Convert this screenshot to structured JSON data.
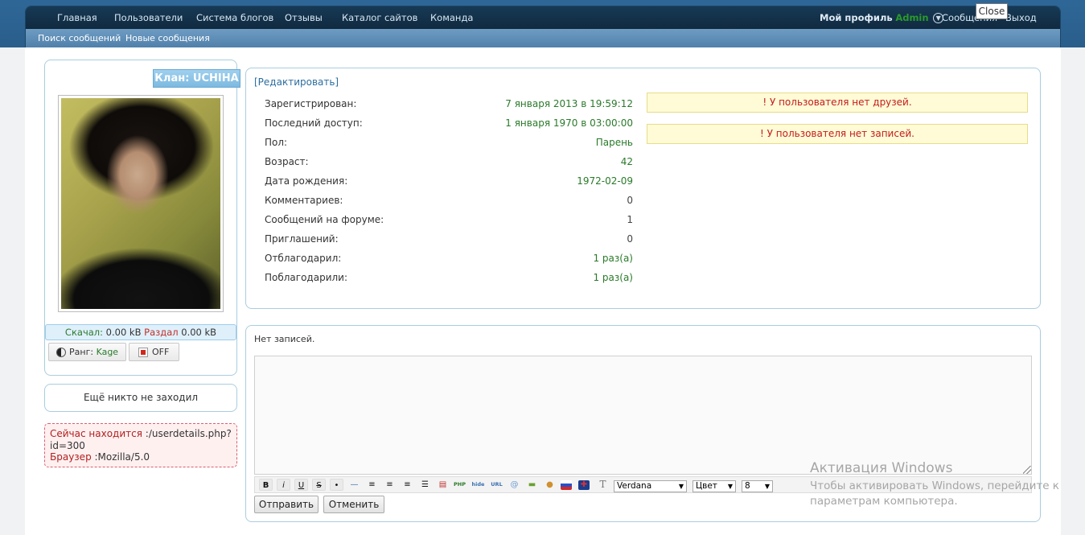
{
  "nav": {
    "main": [
      "Главная",
      "Пользователи",
      "Система блогов",
      "Отзывы",
      "Каталог сайтов",
      "Команда"
    ],
    "right": {
      "profile_label": "Мой профиль",
      "username": "Admin",
      "messages": "Сообщения",
      "logout": "Выход"
    },
    "sub": [
      "Поиск сообщений",
      "Новые сообщения"
    ]
  },
  "tooltip": {
    "close": "Close"
  },
  "sidebar": {
    "clan": "Клан: UCHIHA",
    "ratio": {
      "downloaded_label": "Скачал:",
      "downloaded_value": "0.00 kB",
      "uploaded_label": "Раздал",
      "uploaded_value": "0.00 kB"
    },
    "rank_label": "Ранг:",
    "rank_value": "Kage",
    "status": "OFF",
    "visitors": "Ещё никто не заходил",
    "location_label": "Сейчас находится",
    "location_value": ":/userdetails.php?id=300",
    "browser_label": "Браузер",
    "browser_value": ":Mozilla/5.0"
  },
  "profile": {
    "edit_link": "[Редактировать]",
    "rows": [
      {
        "label": "Зарегистрирован:",
        "value": "7 января 2013 в 19:59:12",
        "color": "green"
      },
      {
        "label": "Последний доступ:",
        "value": "1 января 1970 в 03:00:00",
        "color": "green"
      },
      {
        "label": "Пол:",
        "value": "Парень",
        "color": "green"
      },
      {
        "label": "Возраст:",
        "value": "42",
        "color": "green"
      },
      {
        "label": "Дата рождения:",
        "value": "1972-02-09",
        "color": "green"
      },
      {
        "label": "Комментариев:",
        "value": "0",
        "color": "gray"
      },
      {
        "label": "Сообщений на форуме:",
        "value": "1",
        "color": "gray"
      },
      {
        "label": "Приглашений:",
        "value": "0",
        "color": "gray"
      },
      {
        "label": "Отблагодарил:",
        "value": "1 раз(а)",
        "color": "green"
      },
      {
        "label": "Поблагодарили:",
        "value": "1 раз(а)",
        "color": "green"
      }
    ],
    "notices": [
      "! У пользователя нет друзей.",
      "! У пользователя нет записей."
    ]
  },
  "wall": {
    "empty_text": "Нет записей.",
    "toolbar": {
      "php": "PHP",
      "hide": "hide",
      "url": "URL",
      "font": "Verdana",
      "color": "Цвет",
      "size": "8"
    },
    "submit": "Отправить",
    "cancel": "Отменить"
  },
  "watermark": {
    "title": "Активация Windows",
    "line1": "Чтобы активировать Windows, перейдите к",
    "line2": "параметрам компьютера."
  }
}
